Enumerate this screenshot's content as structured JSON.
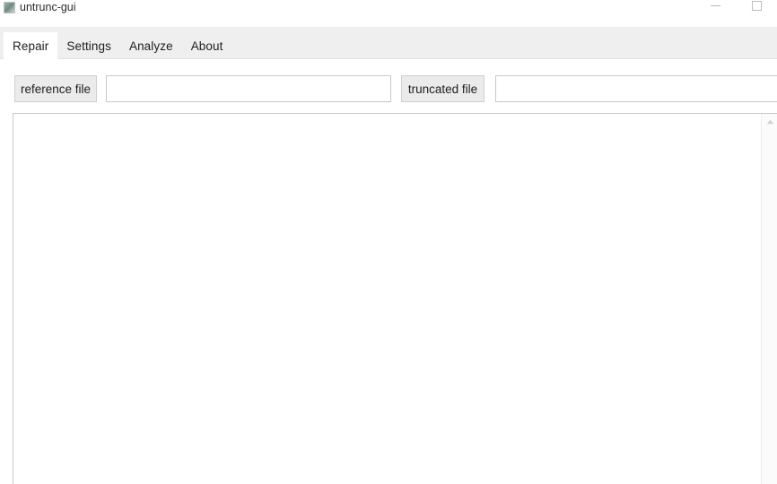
{
  "window": {
    "title": "untrunc-gui",
    "icon": "app-icon",
    "controls": {
      "minimize": "–",
      "maximize": "□"
    }
  },
  "tabs": [
    {
      "label": "Repair",
      "active": true
    },
    {
      "label": "Settings",
      "active": false
    },
    {
      "label": "Analyze",
      "active": false
    },
    {
      "label": "About",
      "active": false
    }
  ],
  "repair": {
    "reference": {
      "button_label": "reference file",
      "value": "",
      "placeholder": ""
    },
    "truncated": {
      "button_label": "truncated file",
      "value": "",
      "placeholder": ""
    },
    "output": {
      "text": ""
    }
  },
  "colors": {
    "tabstrip_bg": "#efefef",
    "active_tab_bg": "#ffffff",
    "button_bg": "#ebebeb",
    "button_border": "#cfcfcf",
    "input_border": "#c8c8c8",
    "output_border": "#c9c9c9",
    "text": "#1d1d1d"
  }
}
